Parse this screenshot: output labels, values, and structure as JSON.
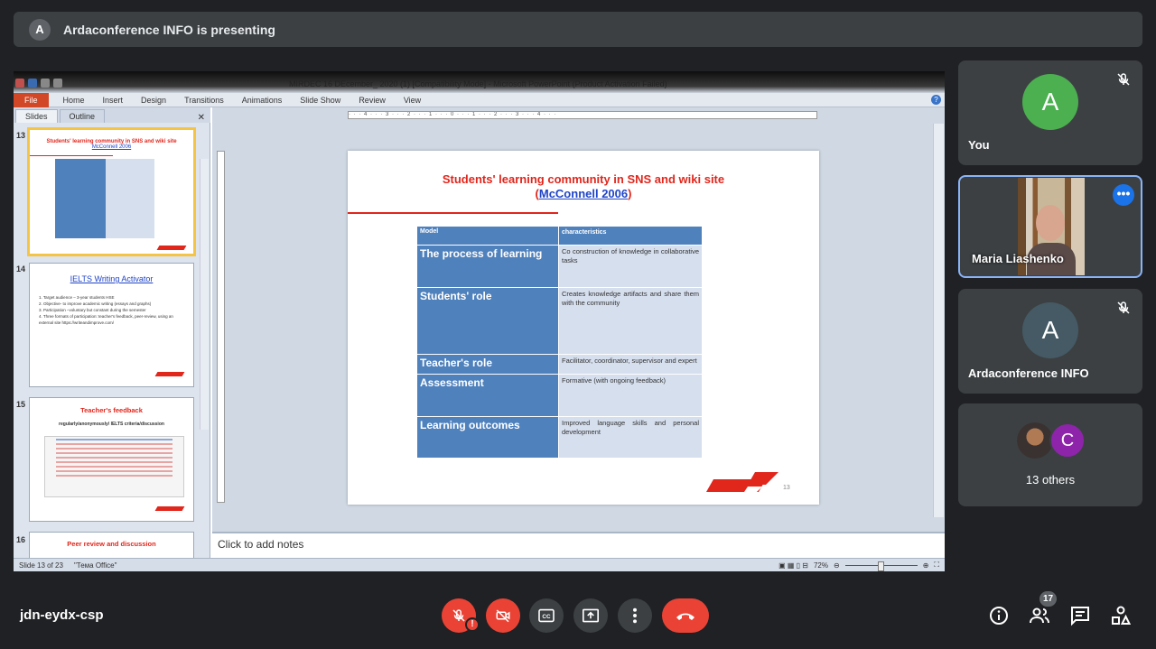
{
  "banner": {
    "avatar_letter": "A",
    "text": "Ardaconference INFO is presenting"
  },
  "ppt": {
    "window_title": "MIRDEC 16 DEcember_ 2020 (1) [Compatibility Mode] - Microsoft PowerPoint (Product Activation Failed)",
    "ribbon_tabs": [
      "File",
      "Home",
      "Insert",
      "Design",
      "Transitions",
      "Animations",
      "Slide Show",
      "Review",
      "View"
    ],
    "pane_tabs": [
      "Slides",
      "Outline"
    ],
    "thumbs": [
      {
        "num": "13",
        "title": "Students' learning community in SNS and wiki site",
        "link": "McConnell 2006"
      },
      {
        "num": "14",
        "title": "IELTS Writing Activator",
        "bullets": [
          "1. Target audience – 3-year students HSE",
          "2. Objective- to improve academic writing (essays and graphs)",
          "3. Participation –voluntary but constant during the semester",
          "4. Three formats of participation: teacher's feedback, peer-review, using an external site https://writeandimprove.com/"
        ]
      },
      {
        "num": "15",
        "title": "Teacher's feedback",
        "subtitle": "regularly/anonymously/ IELTS criteria/discussion"
      },
      {
        "num": "16",
        "title": "Peer review and discussion"
      }
    ],
    "ruler_text": "· · · 4 · · · 3 · · · 2 · · · 1 · · · 0 · · · 1 · · · 2 · · · 3 · · · 4 · · ·",
    "slide": {
      "title": "Students' learning community in SNS and wiki site",
      "link_open": "(",
      "link": "McConnell 2006",
      "link_close": ")",
      "table": [
        {
          "model": "Model",
          "char": "characteristics"
        },
        {
          "model": "The process of learning",
          "char": "Co construction of knowledge in collaborative tasks"
        },
        {
          "model": "Students' role",
          "char": "Creates knowledge artifacts and share them with the community"
        },
        {
          "model": "Teacher's role",
          "char": "Facilitator, coordinator, supervisor and expert"
        },
        {
          "model": "Assessment",
          "char": "Formative (with ongoing feedback)"
        },
        {
          "model": "Learning outcomes",
          "char": "Improved language skills and personal development"
        }
      ],
      "page_number": "13"
    },
    "notes_placeholder": "Click to add notes",
    "status": {
      "slide": "Slide 13 of 23",
      "theme": "\"Тема Office\"",
      "zoom": "72%"
    }
  },
  "participants": [
    {
      "letter": "A",
      "name": "You",
      "color": "#4caf50"
    },
    {
      "name": "Maria Liashenko"
    },
    {
      "letter": "A",
      "name": "Ardaconference INFO",
      "color": "#455a64"
    },
    {
      "letter": "C",
      "name": "13 others",
      "color": "#8e24aa"
    }
  ],
  "meeting_code": "jdn-eydx-csp",
  "people_count": "17",
  "colors": {
    "bg": "#202124",
    "tile": "#3c4043",
    "red": "#ea4335",
    "accent": "#8ab4f8"
  }
}
